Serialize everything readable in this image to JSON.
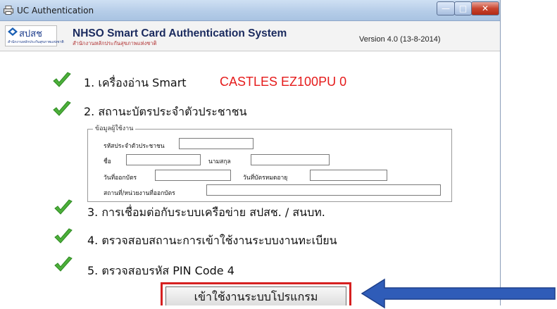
{
  "window": {
    "title": "UC Authentication",
    "buttons": {
      "minimize": "—",
      "maximize": "□",
      "close": "✕"
    }
  },
  "header": {
    "logo_text": "สปสช",
    "logo_sub": "สำนักงานหลักประกันสุขภาพแห่งชาติ",
    "title": "NHSO Smart Card  Authentication System",
    "subtitle": "สำนักงานหลักประกันสุขภาพแห่งชาติ",
    "version": "Version 4.0 (13-8-2014)"
  },
  "steps": [
    {
      "label": "1. เครื่องอ่าน Smart",
      "icon": "check-icon"
    },
    {
      "label": "2. สถานะบัตรประจำตัวประชาชน",
      "icon": "check-icon"
    },
    {
      "label": "3. การเชื่อมต่อกับระบบเครือข่าย สปสช. / สนบท.",
      "icon": "check-icon"
    },
    {
      "label": "4. ตรวจสอบสถานะการเข้าใช้งานระบบงานทะเบียน",
      "icon": "check-icon"
    },
    {
      "label": "5. ตรวจสอบรหัส PIN Code 4",
      "icon": "check-icon"
    }
  ],
  "reader_name": "CASTLES EZ100PU 0",
  "user_info": {
    "legend": "ข้อมูลผู้ใช้งาน",
    "fields": {
      "citizen_id": {
        "label": "รหัสประจำตัวประชาชน",
        "value": ""
      },
      "first_name": {
        "label": "ชื่อ",
        "value": ""
      },
      "last_name": {
        "label": "นามสกุล",
        "value": ""
      },
      "issue_date": {
        "label": "วันที่ออกบัตร",
        "value": ""
      },
      "expire_date": {
        "label": "วันที่บัตรหมดอายุ",
        "value": ""
      },
      "issue_place": {
        "label": "สถานที่/หน่วยงานที่ออกบัตร",
        "value": ""
      }
    }
  },
  "login_button": "เข้าใช้งานระบบโปรแกรม",
  "colors": {
    "check": "#4caf3a",
    "reader_text": "#e51b1b",
    "highlight_border": "#d62020",
    "arrow_fill": "#2f5cb8"
  }
}
